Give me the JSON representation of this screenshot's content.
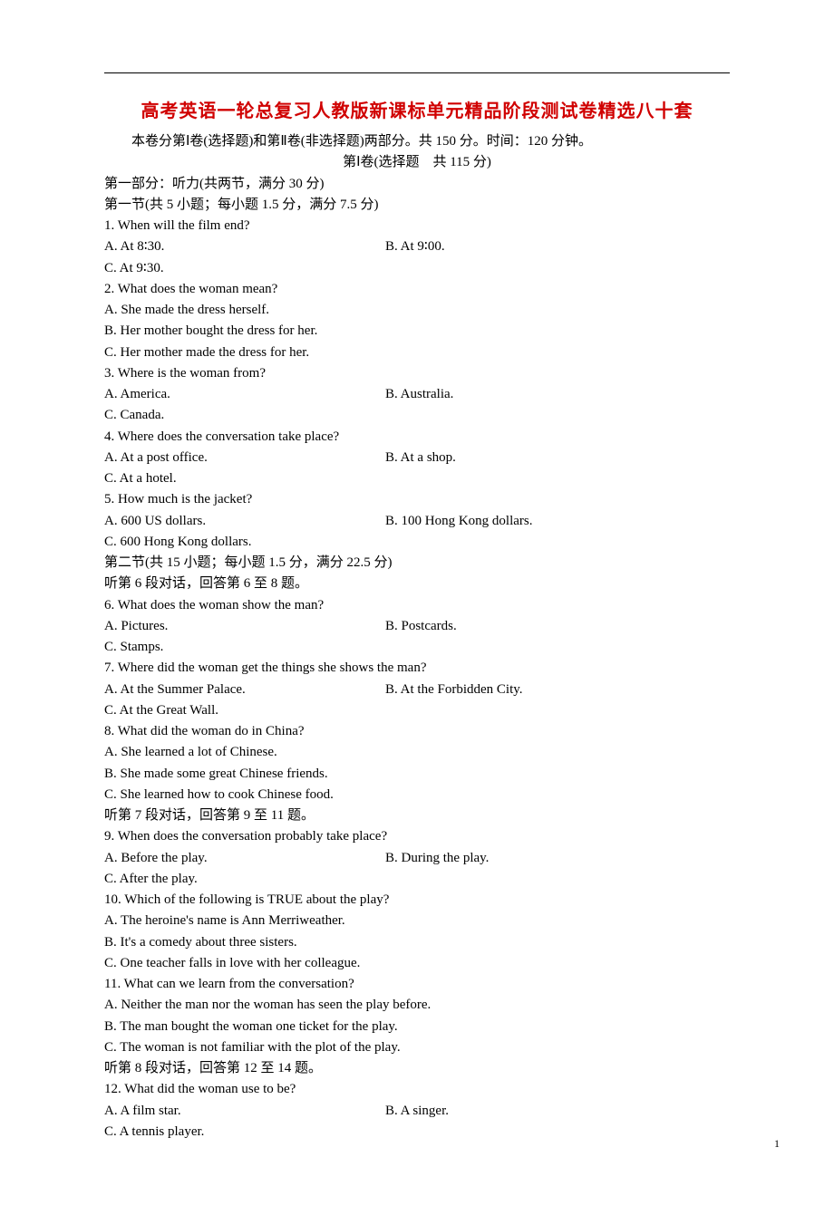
{
  "title": "高考英语一轮总复习人教版新课标单元精品阶段测试卷精选八十套",
  "intro": "本卷分第Ⅰ卷(选择题)和第Ⅱ卷(非选择题)两部分。共 150 分。时间：120 分钟。",
  "part1_header": "第Ⅰ卷(选择题　共 115 分)",
  "section1": "第一部分：听力(共两节，满分 30 分)",
  "subsection1": "第一节(共 5 小题；每小题 1.5 分，满分 7.5 分)",
  "q1": {
    "text": "1. When will the film end?",
    "a": "A. At 8∶30.",
    "b": "B. At 9∶00.",
    "c": "C. At 9∶30."
  },
  "q2": {
    "text": "2. What does the woman mean?",
    "a": "A. She made the dress herself.",
    "b": "B. Her mother bought the dress for her.",
    "c": "C. Her mother made the dress for her."
  },
  "q3": {
    "text": "3. Where is the woman from?",
    "a": "A. America.",
    "b": "B. Australia.",
    "c": "C. Canada."
  },
  "q4": {
    "text": "4. Where does the conversation take place?",
    "a": "A. At a post office.",
    "b": "B. At a shop.",
    "c": "C. At a hotel."
  },
  "q5": {
    "text": "5. How much is the jacket?",
    "a": "A. 600 US dollars.",
    "b": "B. 100 Hong Kong dollars.",
    "c": "C. 600 Hong Kong dollars."
  },
  "subsection2": "第二节(共 15 小题；每小题 1.5 分，满分 22.5 分)",
  "dialogue6": "听第 6 段对话，回答第 6 至 8 题。",
  "q6": {
    "text": "6. What does the woman show the man?",
    "a": "A. Pictures.",
    "b": "B. Postcards.",
    "c": "C. Stamps."
  },
  "q7": {
    "text": "7. Where did the woman get the things she shows the man?",
    "a": "A. At the Summer Palace.",
    "b": "B. At the Forbidden City.",
    "c": "C. At the Great Wall."
  },
  "q8": {
    "text": "8. What did the woman do in China?",
    "a": "A. She learned a lot of Chinese.",
    "b": "B. She made some great Chinese friends.",
    "c": "C. She learned how to cook Chinese food."
  },
  "dialogue7": "听第 7 段对话，回答第 9 至 11 题。",
  "q9": {
    "text": "9. When does the conversation probably take place?",
    "a": "A. Before the play.",
    "b": "B. During the play.",
    "c": "C. After the play."
  },
  "q10": {
    "text": "10. Which of the following is TRUE about the play?",
    "a": "A. The heroine's name is Ann Merriweather.",
    "b": "B. It's a comedy about three sisters.",
    "c": "C. One teacher falls in love with her colleague."
  },
  "q11": {
    "text": "11. What can we learn from the conversation?",
    "a": "A. Neither the man nor the woman has seen the play before.",
    "b": "B. The man bought the woman one ticket for the play.",
    "c": "C. The woman is not familiar with the plot of the play."
  },
  "dialogue8": "听第 8 段对话，回答第 12 至 14 题。",
  "q12": {
    "text": "12. What did the woman use to be?",
    "a": "A. A film star.",
    "b": "B. A singer.",
    "c": "C. A tennis player."
  },
  "page_number": "1"
}
